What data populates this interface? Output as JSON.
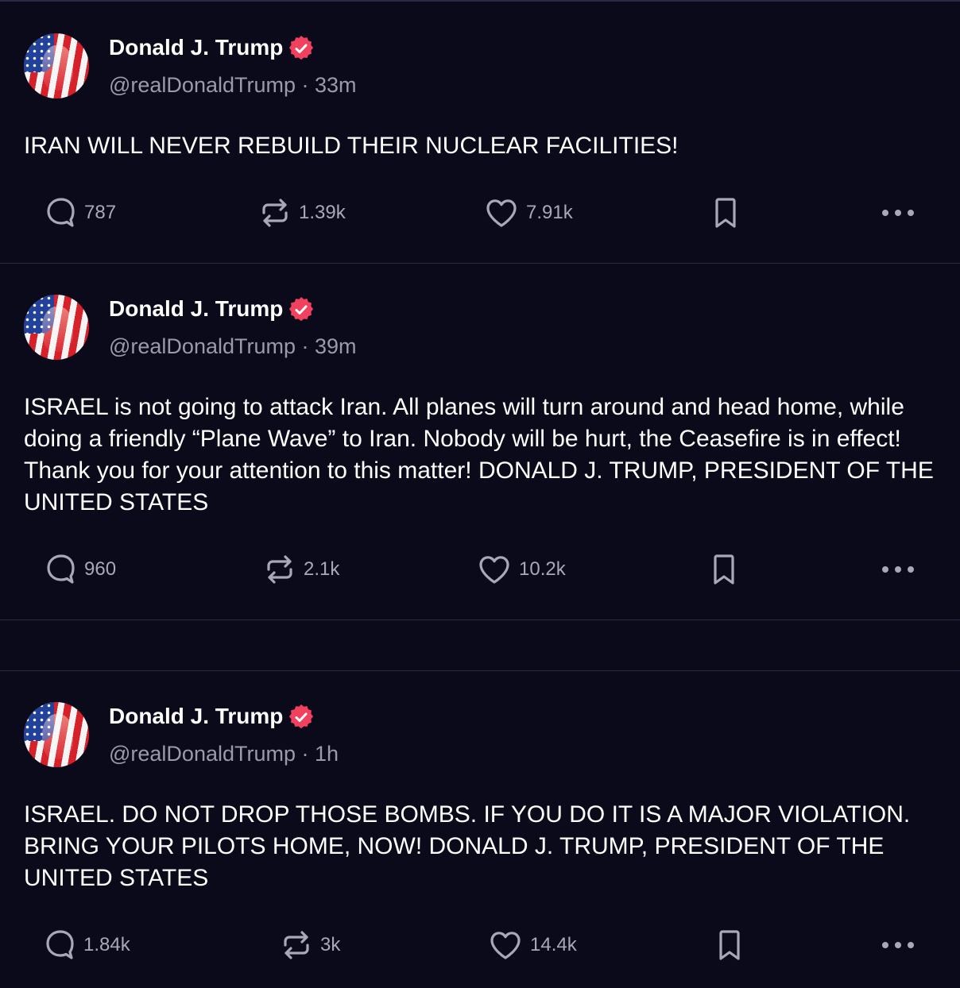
{
  "posts": [
    {
      "author": "Donald J. Trump",
      "handle_time": "@realDonaldTrump · 33m",
      "text": "IRAN WILL NEVER REBUILD THEIR NUCLEAR FACILITIES!",
      "replies": "787",
      "reposts": "1.39k",
      "likes": "7.91k"
    },
    {
      "author": "Donald J. Trump",
      "handle_time": "@realDonaldTrump · 39m",
      "text": "ISRAEL is not going to attack Iran. All planes will turn around and head home, while doing a friendly “Plane Wave” to Iran. Nobody will be hurt, the Ceasefire is in effect! Thank you for your attention to this matter! DONALD J. TRUMP, PRESIDENT OF THE UNITED STATES",
      "replies": "960",
      "reposts": "2.1k",
      "likes": "10.2k"
    },
    {
      "author": "Donald J. Trump",
      "handle_time": "@realDonaldTrump · 1h",
      "text": "ISRAEL. DO NOT DROP THOSE BOMBS. IF YOU DO IT IS A MAJOR VIOLATION. BRING YOUR PILOTS HOME, NOW!  DONALD J. TRUMP, PRESIDENT OF THE UNITED STATES",
      "replies": "1.84k",
      "reposts": "3k",
      "likes": "14.4k"
    }
  ],
  "icons": {
    "reply": "reply-icon",
    "repost": "repost-icon",
    "like": "heart-icon",
    "bookmark": "bookmark-icon",
    "more": "more-icon",
    "verified": "verified-badge-icon"
  },
  "colors": {
    "background": "#0b0a1b",
    "verified_badge": "#f2415f",
    "muted_text": "#9b9aab"
  }
}
